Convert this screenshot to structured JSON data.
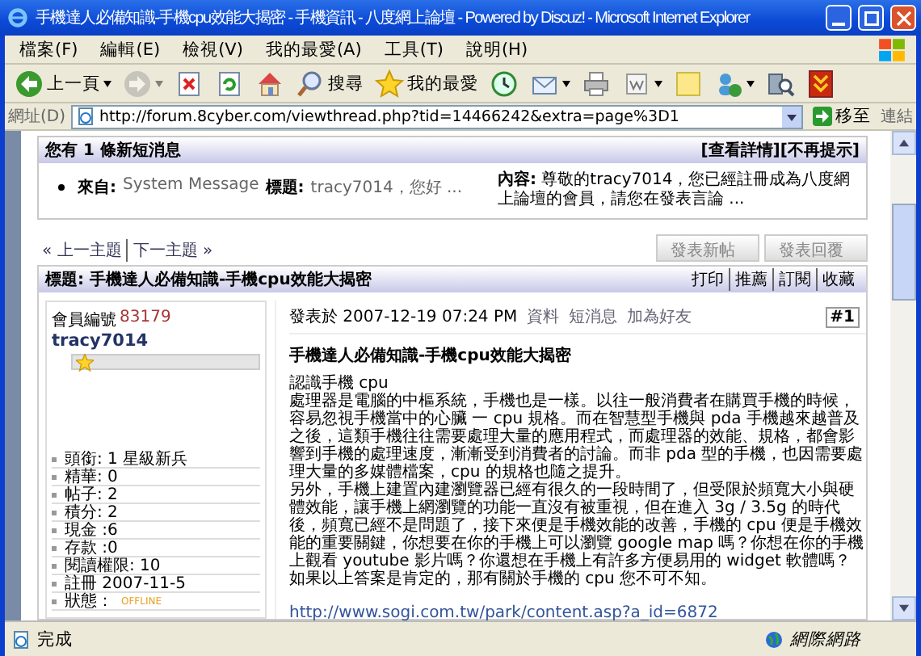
{
  "window": {
    "title": "手機達人必備知識-手機cpu效能大揭密 - 手機資訊 - 八度網上論壇 - Powered by Discuz! - Microsoft Internet Explorer"
  },
  "menu_bar": {
    "items": [
      "檔案(F)",
      "編輯(E)",
      "檢視(V)",
      "我的最愛(A)",
      "工具(T)",
      "說明(H)"
    ]
  },
  "toolbar": {
    "buttons": [
      {
        "kind": "back",
        "label": "上一頁",
        "dropdown": true,
        "disabled": false
      },
      {
        "kind": "forward",
        "dropdown": true,
        "disabled": true
      },
      {
        "kind": "stop",
        "dropdown": false,
        "disabled": false
      },
      {
        "kind": "refresh",
        "dropdown": false,
        "disabled": false
      },
      {
        "kind": "home",
        "dropdown": false,
        "disabled": false
      },
      {
        "kind": "search",
        "label": "搜尋",
        "dropdown": false,
        "disabled": false
      },
      {
        "kind": "favorites",
        "label": "我的最愛",
        "dropdown": false,
        "disabled": false
      },
      {
        "kind": "history",
        "dropdown": false,
        "disabled": false
      },
      {
        "kind": "mail",
        "dropdown": true,
        "disabled": false
      },
      {
        "kind": "print",
        "dropdown": false,
        "disabled": false
      },
      {
        "kind": "edit",
        "dropdown": true,
        "disabled": false
      },
      {
        "kind": "note",
        "dropdown": false,
        "disabled": false
      },
      {
        "kind": "messenger",
        "dropdown": true,
        "disabled": false
      },
      {
        "kind": "research",
        "dropdown": false,
        "disabled": false
      },
      {
        "kind": "download",
        "dropdown": false,
        "disabled": false
      }
    ]
  },
  "address_bar": {
    "label": "網址(D)",
    "url": "http://forum.8cyber.com/viewthread.php?tid=14466242&extra=page%3D1",
    "go": "移至",
    "links": "連結"
  },
  "message_box": {
    "title": "您有 1 條新短消息",
    "actions": [
      "[查看詳情]",
      "[不再提示]"
    ],
    "messages": [
      {
        "from_label": "來自:",
        "from": "System Message",
        "subject_label": "標題:",
        "subject": "tracy7014，您好 ...",
        "content_label": "內容:",
        "content": "尊敬的tracy7014，您已經註冊成為八度網上論壇的會員，請您在發表言論 ..."
      }
    ]
  },
  "thread_nav": {
    "links": [
      "« 上一主題",
      "下一主題 »"
    ],
    "buttons": [
      "發表新帖",
      "發表回覆"
    ]
  },
  "post": {
    "title": "標題: 手機達人必備知識-手機cpu效能大揭密",
    "actions": [
      "打印",
      "推薦",
      "訂閱",
      "收藏"
    ],
    "author": {
      "member_no_label": "會員編號",
      "member_no": "83179",
      "username": "tracy7014",
      "stats": [
        "頭銜: 1 星級新兵",
        "精華: 0",
        "帖子: 2",
        "積分: 2",
        "現金 :6",
        "存款 :0",
        "閱讀權限: 10",
        "註冊 2007-11-5"
      ],
      "status_label": "狀態：",
      "status": "OFFLINE"
    },
    "posted": "發表於 2007-12-19 07:24 PM",
    "links": [
      "資料",
      "短消息",
      "加為好友"
    ],
    "floor": "#1",
    "heading": "手機達人必備知識-手機cpu效能大揭密",
    "paragraphs": [
      "認識手機 cpu",
      "處理器是電腦的中樞系統，手機也是一樣。以往一般消費者在購買手機的時候，容易忽視手機當中的心臟 一 cpu 規格。而在智慧型手機與 pda 手機越來越普及之後，這類手機往往需要處理大量的應用程式，而處理器的效能、規格，都會影響到手機的處理速度，漸漸受到消費者的討論。而非 pda 型的手機，也因需要處理大量的多媒體檔案，cpu 的規格也隨之提升。",
      "另外，手機上建置內建瀏覽器已經有很久的一段時間了，但受限於頻寬大小與硬體效能，讓手機上網瀏覽的功能一直沒有被重視，但在進入 3g / 3.5g 的時代後，頻寬已經不是問題了，接下來便是手機效能的改善，手機的 cpu 便是手機效能的重要關鍵，你想要在你的手機上可以瀏覽 google map 嗎？你想在你的手機上觀看 youtube 影片嗎？你還想在手機上有許多方便易用的 widget 軟體嗎？如果以上答案是肯定的，那有關於手機的 cpu 您不可不知。"
    ],
    "link": "http://www.sogi.com.tw/park/content.asp?a_id=6872"
  },
  "status_bar": {
    "text": "完成",
    "zone": "網際網路"
  }
}
